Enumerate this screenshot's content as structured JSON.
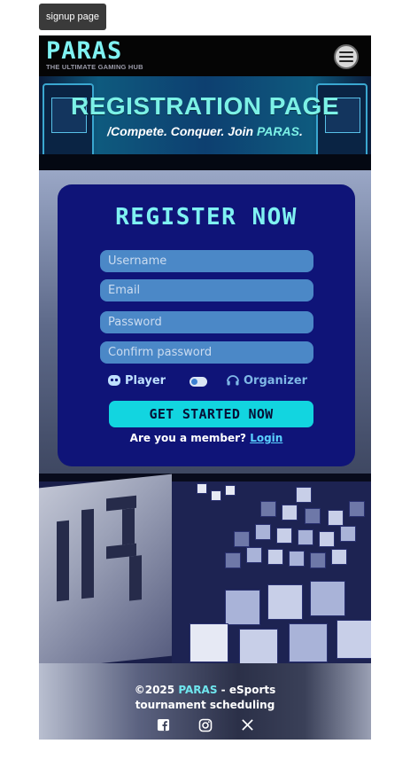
{
  "tab": {
    "label": "signup page"
  },
  "header": {
    "brand_name": "PARAS",
    "brand_tagline": "THE ULTIMATE GAMING HUB",
    "menu_icon": "hamburger-menu-icon"
  },
  "banner": {
    "title": "REGISTRATION PAGE",
    "subtitle_prefix": "/Compete. Conquer. Join ",
    "subtitle_brand": "PARAS",
    "subtitle_suffix": "."
  },
  "form": {
    "title": "REGISTER NOW",
    "fields": {
      "username_placeholder": "Username",
      "email_placeholder": "Email",
      "password_placeholder": "Password",
      "confirm_placeholder": "Confirm password"
    },
    "roles": {
      "player_label": "Player",
      "organizer_label": "Organizer",
      "player_icon": "gamepad-icon",
      "organizer_icon": "headset-icon"
    },
    "submit_label": "GET STARTED NOW",
    "member_prompt": "Are you a member?",
    "login_link": "Login"
  },
  "footer": {
    "copyright_prefix": "©2025",
    "brand": "PARAS",
    "copyright_suffix": "- eSports",
    "line2": "tournament scheduling",
    "social_icons": [
      "facebook-icon",
      "instagram-icon",
      "x-icon"
    ]
  },
  "colors": {
    "accent": "#7ff2f2",
    "card": "#0f1478",
    "input": "#4b88c7",
    "cta": "#12d5e0"
  }
}
